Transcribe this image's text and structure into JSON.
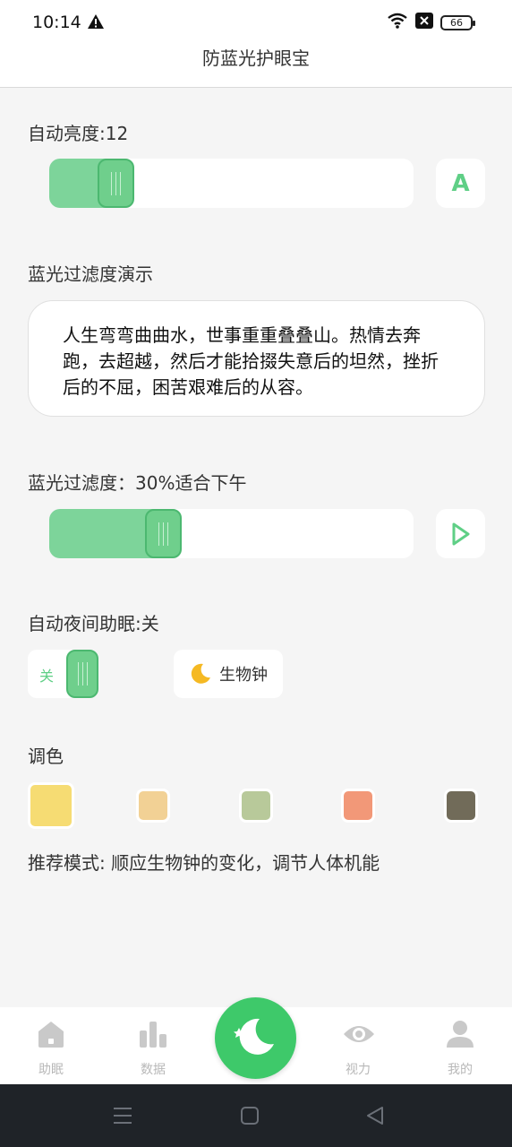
{
  "status": {
    "time": "10:14",
    "battery": "66"
  },
  "header": {
    "title": "防蓝光护眼宝"
  },
  "brightness": {
    "label": "自动亮度:12",
    "button": "A",
    "level_percent": 17
  },
  "demo": {
    "section_label": "蓝光过滤度演示",
    "text": "人生弯弯曲曲水，世事重重叠叠山。热情去奔跑，去超越，然后才能拾掇失意后的坦然，挫折后的不屈，困苦艰难后的从容。"
  },
  "filter": {
    "label": "蓝光过滤度：30%适合下午",
    "level_percent": 30
  },
  "night": {
    "label": "自动夜间助眠:关",
    "toggle_text": "关",
    "clock_button": "生物钟"
  },
  "palette": {
    "label": "调色",
    "colors": [
      "#f6dc73",
      "#f2d195",
      "#b8c99a",
      "#f29878",
      "#716b59"
    ],
    "selected_index": 0
  },
  "tip": "推荐模式: 顺应生物钟的变化，调节人体机能",
  "tabs": [
    "助眠",
    "数据",
    "视力",
    "我的"
  ]
}
